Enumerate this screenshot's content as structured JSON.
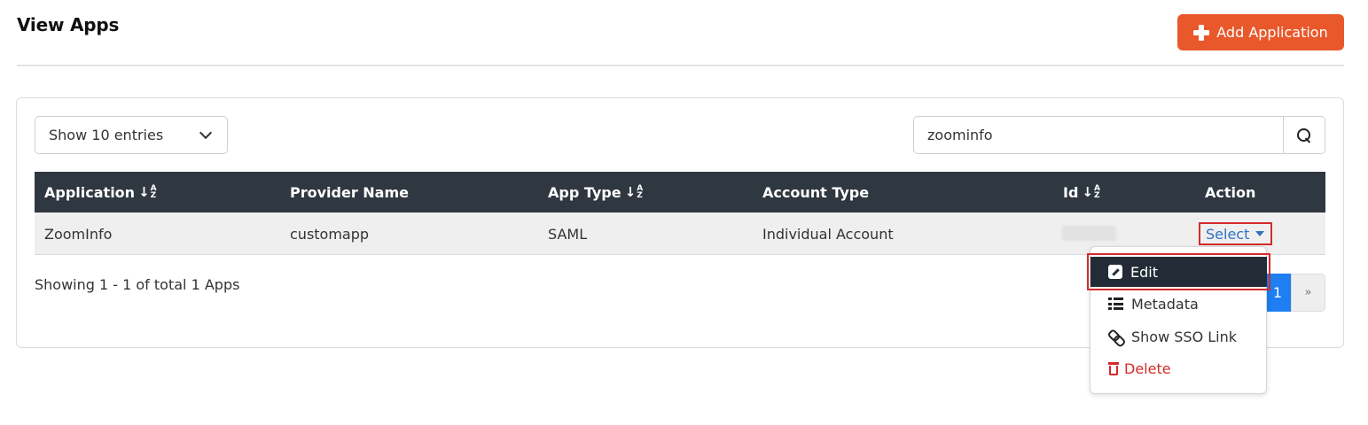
{
  "header": {
    "title": "View Apps",
    "add_button_label": "Add Application"
  },
  "controls": {
    "entries_label": "Show 10 entries",
    "search_value": "zoominfo"
  },
  "table": {
    "columns": [
      {
        "label": "Application",
        "sortable": true
      },
      {
        "label": "Provider Name",
        "sortable": false
      },
      {
        "label": "App Type",
        "sortable": true
      },
      {
        "label": "Account Type",
        "sortable": false
      },
      {
        "label": "Id",
        "sortable": true
      },
      {
        "label": "Action",
        "sortable": false
      }
    ],
    "rows": [
      {
        "application": "ZoomInfo",
        "provider_name": "customapp",
        "app_type": "SAML",
        "account_type": "Individual Account",
        "action_label": "Select"
      }
    ]
  },
  "footer": {
    "showing_text": "Showing 1 - 1 of total 1 Apps",
    "current_page": "1",
    "next_label": "»"
  },
  "action_menu": {
    "items": [
      {
        "label": "Edit",
        "icon": "pencil-square-icon"
      },
      {
        "label": "Metadata",
        "icon": "list-icon"
      },
      {
        "label": "Show SSO Link",
        "icon": "link-icon"
      },
      {
        "label": "Delete",
        "icon": "trash-icon"
      }
    ]
  },
  "colors": {
    "accent": "#e9582b",
    "header_bg": "#2f3740",
    "link": "#2f72c4",
    "danger": "#d52a2a",
    "page_active": "#1e7ef2"
  }
}
